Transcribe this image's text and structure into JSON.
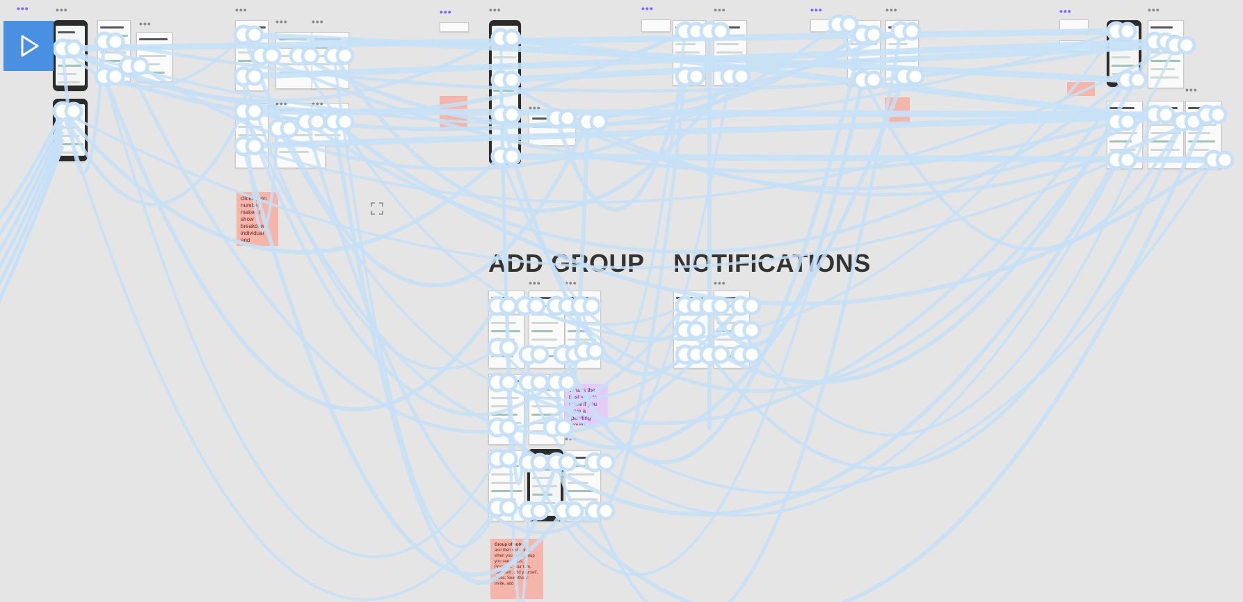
{
  "app": "Figma prototype view",
  "toolbar": {
    "play_icon": "play-icon"
  },
  "sections": {
    "add_group": "ADD GROUP",
    "notifications": "NOTIFICATIONS"
  },
  "stickies": {
    "top_left": "clicking on number makes it show breakdown individual and",
    "mid_purple": "What's the best way to show if you have a \"pending\" group?",
    "bottom_title": "Group of notes",
    "bottom_lines": "and then some text; when you tap a group you see details; Progress: your turn, next item; add yourself, notes; See others: invite, add"
  },
  "colors": {
    "canvas": "#e5e5e5",
    "connector": "#c6e1f7",
    "hotspot": "#ffffff",
    "accent": "#4a90e2",
    "sticky": "#f4b6ab",
    "sticky_purple": "#e3ccf7"
  },
  "icons": [
    "play-icon",
    "focus-frame-icon"
  ]
}
